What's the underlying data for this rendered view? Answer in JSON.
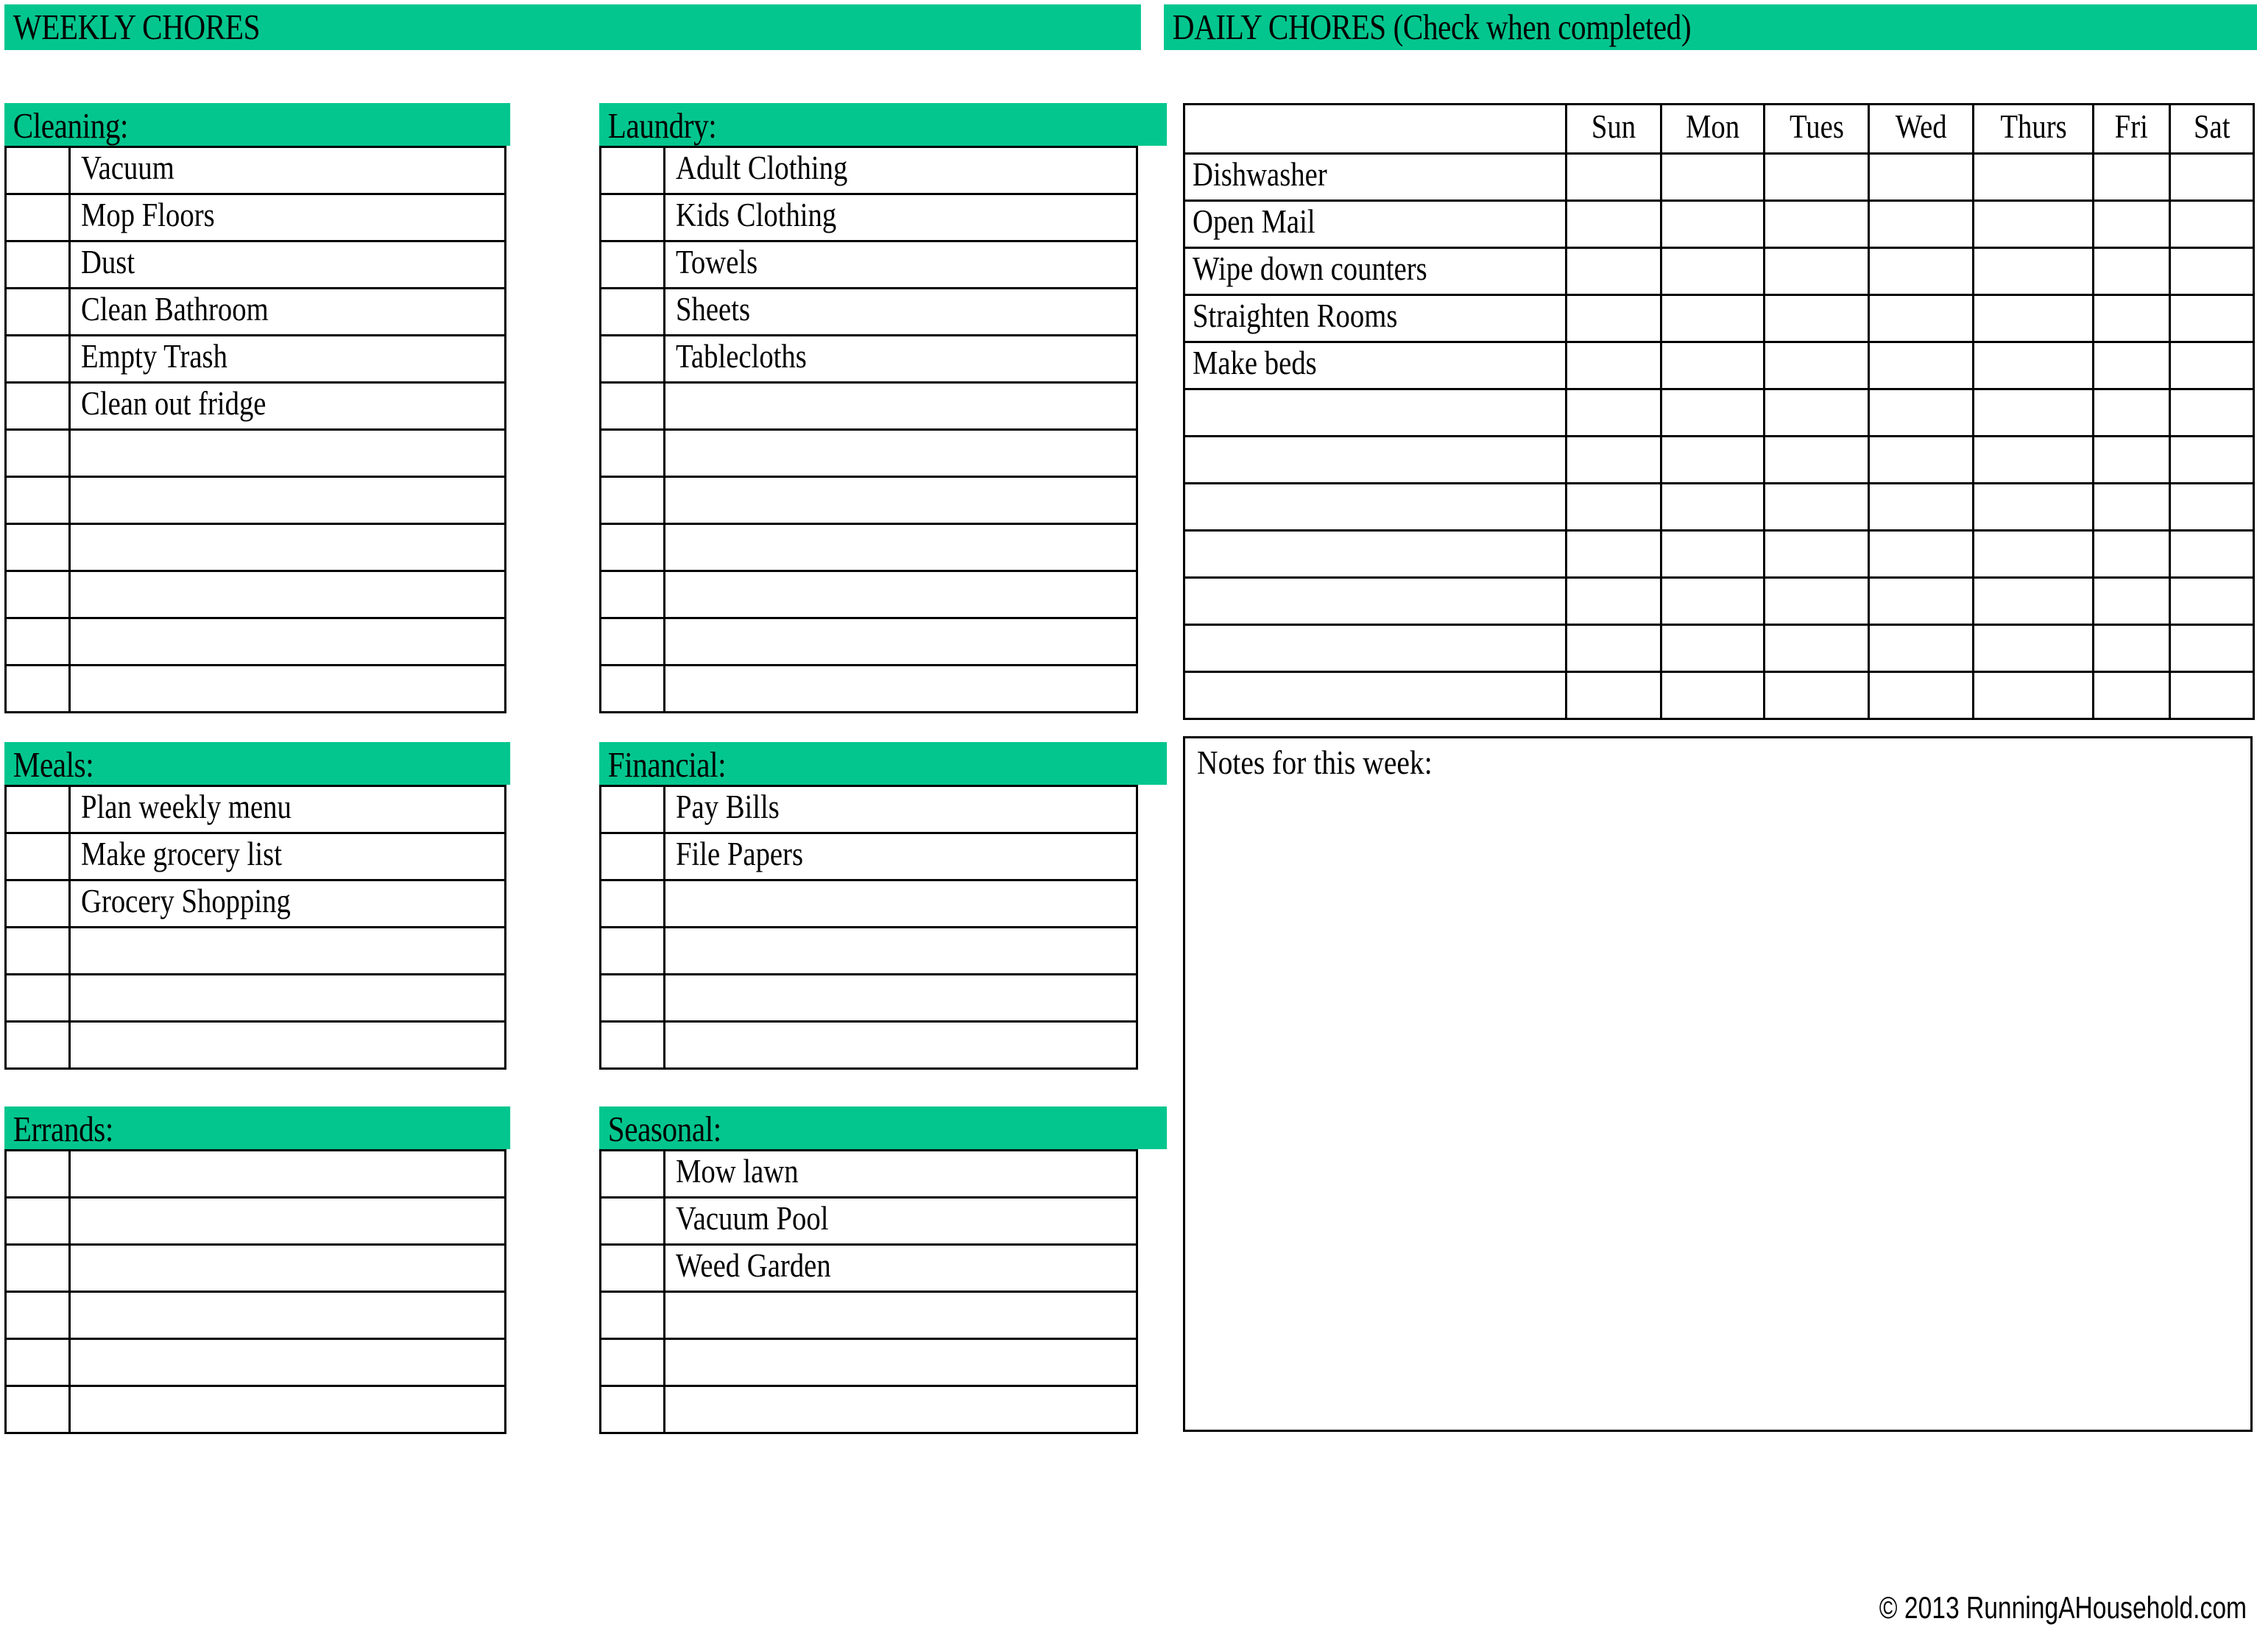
{
  "page": {
    "accent_color": "#03c68e",
    "background_color": "#ffffff",
    "text_color": "#000000"
  },
  "headers": {
    "weekly": "WEEKLY CHORES",
    "daily": "DAILY CHORES (Check when completed)"
  },
  "weekly_sections": {
    "cleaning": {
      "title": "Cleaning:",
      "rows": 12,
      "items": [
        "Vacuum",
        "Mop Floors",
        "Dust",
        "Clean Bathroom",
        "Empty Trash",
        "Clean out fridge",
        "",
        "",
        "",
        "",
        "",
        ""
      ]
    },
    "laundry": {
      "title": "Laundry:",
      "rows": 12,
      "items": [
        "Adult Clothing",
        "Kids Clothing",
        "Towels",
        "Sheets",
        "Tablecloths",
        "",
        "",
        "",
        "",
        "",
        "",
        ""
      ]
    },
    "meals": {
      "title": "Meals:",
      "rows": 6,
      "items": [
        "Plan weekly menu",
        "Make grocery list",
        "Grocery Shopping",
        "",
        "",
        ""
      ]
    },
    "financial": {
      "title": "Financial:",
      "rows": 6,
      "items": [
        "Pay Bills",
        "File Papers",
        "",
        "",
        "",
        ""
      ]
    },
    "errands": {
      "title": "Errands:",
      "rows": 6,
      "items": [
        "",
        "",
        "",
        "",
        "",
        ""
      ]
    },
    "seasonal": {
      "title": "Seasonal:",
      "rows": 6,
      "items": [
        "Mow lawn",
        "Vacuum Pool",
        "Weed Garden",
        "",
        "",
        ""
      ]
    }
  },
  "daily_chores": {
    "corner_header": "",
    "day_headers": [
      "Sun",
      "Mon",
      "Tues",
      "Wed",
      "Thurs",
      "Fri",
      "Sat"
    ],
    "tasks": [
      "Dishwasher",
      "Open Mail",
      "Wipe down counters",
      "Straighten Rooms",
      "Make beds",
      "",
      "",
      "",
      "",
      "",
      "",
      ""
    ]
  },
  "notes": {
    "label": "Notes for this week:",
    "value": ""
  },
  "footer": {
    "copyright": "© 2013 RunningAHousehold.com"
  }
}
